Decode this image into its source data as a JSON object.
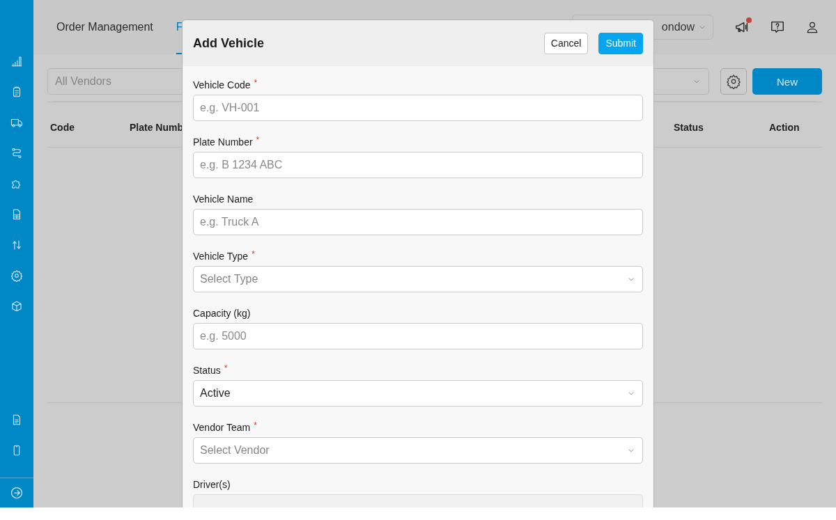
{
  "header": {
    "tabs": [
      {
        "label": "Order Management",
        "selected": false
      },
      {
        "label": "F",
        "selected": true
      }
    ],
    "org_select": {
      "value": "ondow"
    }
  },
  "filters": {
    "vendor_select": {
      "placeholder": "All Vendors"
    },
    "new_button": "New"
  },
  "table": {
    "columns": [
      "Code",
      "Plate Numb",
      "Status",
      "Action"
    ]
  },
  "modal": {
    "title": "Add Vehicle",
    "buttons": [
      {
        "label": "Cancel",
        "kind": "secondary"
      },
      {
        "label": "Submit",
        "kind": "primary"
      }
    ],
    "fields": [
      {
        "label": "Vehicle Code",
        "required_mark": "*",
        "kind": "text",
        "placeholder": "e.g. VH-001"
      },
      {
        "label": "Plate Number",
        "required_mark": "*",
        "kind": "text",
        "placeholder": "e.g. B 1234 ABC"
      },
      {
        "label": "Vehicle Name",
        "kind": "text",
        "placeholder": "e.g. Truck A"
      },
      {
        "label": "Vehicle Type",
        "required_mark": "*",
        "kind": "select",
        "placeholder": "Select Type"
      },
      {
        "label": "Capacity (kg)",
        "kind": "text",
        "placeholder": "e.g. 5000"
      },
      {
        "label": "Status",
        "required_mark": "*",
        "kind": "select",
        "value": "Active"
      },
      {
        "label": "Vendor Team",
        "required_mark": "*",
        "kind": "select",
        "placeholder": "Select Vendor"
      },
      {
        "label": "Driver(s)",
        "kind": "select",
        "disabled": true
      }
    ]
  }
}
